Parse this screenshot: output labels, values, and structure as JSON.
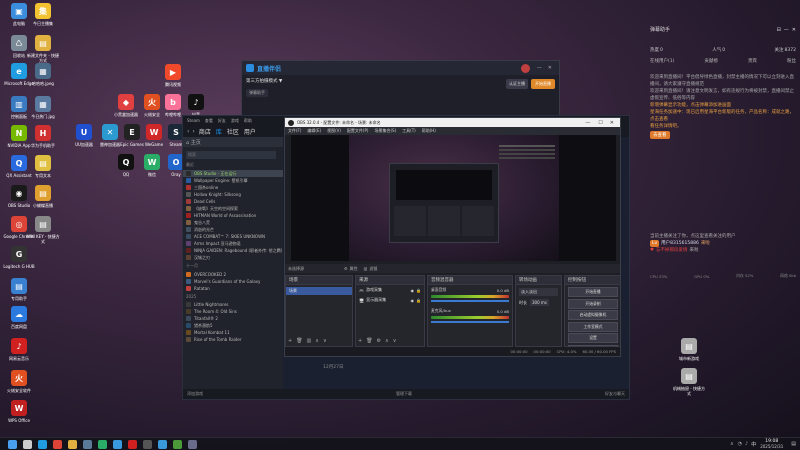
{
  "desktop": {
    "icons": [
      {
        "label": "此电脑",
        "color": "#3b8edb",
        "glyph": "▣"
      },
      {
        "label": "今日主播集",
        "color": "#f2c230",
        "glyph": "集"
      },
      {
        "label": "回收站",
        "color": "#7a8a96",
        "glyph": "♺"
      },
      {
        "label": "新建文件夹 - 快捷方式",
        "color": "#e0b040",
        "glyph": "▤"
      },
      {
        "label": "Microsoft Edge",
        "color": "#1f9de0",
        "glyph": "e"
      },
      {
        "label": "哈哈哈.jpeg",
        "color": "#4a6a8a",
        "glyph": "▦"
      },
      {
        "label": "控制面板",
        "color": "#3a7ac0",
        "glyph": "▥"
      },
      {
        "label": "今日热门.jpg",
        "color": "#5a7aa0",
        "glyph": "▦"
      },
      {
        "label": "NVIDIA App",
        "color": "#76b900",
        "glyph": "N"
      },
      {
        "label": "华为手机助手",
        "color": "#d03030",
        "glyph": "H"
      },
      {
        "label": "QX Assistant",
        "color": "#2a6adf",
        "glyph": "Q"
      },
      {
        "label": "专用文本",
        "color": "#e0c040",
        "glyph": "▤"
      },
      {
        "label": "OBS Studio",
        "color": "#1a1a1a",
        "glyph": "◉"
      },
      {
        "label": "小蝴蝶直播",
        "color": "#e0a030",
        "glyph": "▤"
      },
      {
        "label": "Google Chrome",
        "color": "#db4437",
        "glyph": "◎"
      },
      {
        "label": "MIKI KEY - 快捷方式",
        "color": "#888",
        "glyph": "▤"
      },
      {
        "label": "Logitech G HUB",
        "color": "#333",
        "glyph": "G"
      },
      {
        "label": "专用助手",
        "color": "#3a80d0",
        "glyph": "▤"
      },
      {
        "label": "百度网盘",
        "color": "#2a7ae0",
        "glyph": "☁"
      },
      {
        "label": "网易云音乐",
        "color": "#d02020",
        "glyph": "♪"
      },
      {
        "label": "火绒安全软件",
        "color": "#e05020",
        "glyph": "火"
      },
      {
        "label": "WPS Office",
        "color": "#c02020",
        "glyph": "W"
      }
    ],
    "middle_icons": [
      {
        "label": "腾讯视频",
        "color": "#f04a2a",
        "glyph": "▶"
      },
      {
        "label": "小黑盒加速器",
        "color": "#e04040",
        "glyph": "◆"
      },
      {
        "label": "火绒安全",
        "color": "#e05020",
        "glyph": "火"
      },
      {
        "label": "哔哩哔哩",
        "color": "#fb7299",
        "glyph": "b"
      },
      {
        "label": "抖音",
        "color": "#111",
        "glyph": "♪"
      },
      {
        "label": "UU加速器",
        "color": "#2050d0",
        "glyph": "U"
      },
      {
        "label": "雷神加速器",
        "color": "#2a9ad0",
        "glyph": "✕"
      },
      {
        "label": "Epic Games",
        "color": "#222",
        "glyph": "E"
      },
      {
        "label": "WeGame",
        "color": "#d02828",
        "glyph": "W"
      },
      {
        "label": "Steam",
        "color": "#1b2838",
        "glyph": "S"
      },
      {
        "label": "QQ",
        "color": "#111",
        "glyph": "Q"
      },
      {
        "label": "微信",
        "color": "#2aae67",
        "glyph": "W"
      },
      {
        "label": "Oray",
        "color": "#2266cc",
        "glyph": "O"
      }
    ]
  },
  "stream_app": {
    "title": "直播伴侣",
    "room": "第三方拍摄模式 ▼",
    "viewers": "弹幕助手",
    "live_label": "开始直播",
    "mic": "专注",
    "btn1": "认证主播",
    "btn2": "分享"
  },
  "steam": {
    "menu": [
      "Steam",
      "查看",
      "好友",
      "游戏",
      "帮助"
    ],
    "nav": [
      "商店",
      "库",
      "社区",
      "用户"
    ],
    "search": "搜索",
    "section_recent": "最近",
    "games": [
      {
        "name": "OBS Studio - 正在运行",
        "color": "#2a2a2a",
        "active": true
      },
      {
        "name": "Wallpaper Engine: 壁纸引擎",
        "color": "#2a5aa0"
      },
      {
        "name": "三国杀online",
        "color": "#b03030"
      },
      {
        "name": "Hollow Knight: Silksong",
        "color": "#555"
      },
      {
        "name": "Dead Cells",
        "color": "#a03a3a"
      },
      {
        "name": "《缺氧》天空的空间探索",
        "color": "#806040"
      },
      {
        "name": "HITMAN World of Assassination",
        "color": "#a02020"
      },
      {
        "name": "鬼谷八荒",
        "color": "#806040"
      },
      {
        "name": "消逝的光芒",
        "color": "#405060"
      },
      {
        "name": "ACE COMBAT™ 7: SKIES UNKNOWN",
        "color": "#3a4a60"
      },
      {
        "name": "Arms Impact 亚马逊物语",
        "color": "#604070"
      },
      {
        "name": "NINJA GAIDEN: Ragebound (职者外传: 怒之羁)",
        "color": "#602020"
      },
      {
        "name": "汉城之刃",
        "color": "#5a4030"
      }
    ],
    "section_other": "十一月",
    "games2": [
      {
        "name": "OVERCOOKED 2",
        "color": "#d06a20"
      },
      {
        "name": "Marvel's Guardians of the Galaxy",
        "color": "#3a5a80"
      },
      {
        "name": "Ratatan",
        "color": "#c04040"
      }
    ],
    "section_year": "2025",
    "games3": [
      {
        "name": "Little Nightmares",
        "color": "#3a3a3a"
      },
      {
        "name": "The Room 4: Old Sins",
        "color": "#4a3a2a"
      },
      {
        "name": "Titanfall® 2",
        "color": "#3a4a5a"
      },
      {
        "name": "猎杀潜航5",
        "color": "#2a4a6a"
      },
      {
        "name": "Mortal Kombat 11",
        "color": "#6a4a20"
      },
      {
        "name": "Rise of the Tomb Raider",
        "color": "#5a4a3a"
      }
    ],
    "add_game": "添加游戏",
    "downloads": "管理下载",
    "friends": "好友与聊天"
  },
  "obs": {
    "title": "OBS 32.0.4 - 配置文件: 未命名 - 场景: 未命名",
    "menu": [
      "文件(F)",
      "编辑(E)",
      "视图(V)",
      "配置文件(P)",
      "场景集合(S)",
      "工具(T)",
      "帮助(H)"
    ],
    "no_source": "未选择源",
    "properties": "属性",
    "filters": "滤镜",
    "scenes_title": "场景",
    "scene_item": "场景",
    "sources_title": "来源",
    "sources": [
      "游戏采集",
      "显示器采集"
    ],
    "mixer_title": "音频混音器",
    "audio1": "桌面音频",
    "audio1_db": "0.0 dB",
    "audio2": "麦克风/Aux",
    "audio2_db": "0.0 dB",
    "trans_title": "转场动画",
    "trans_type": "淡入淡出",
    "duration_label": "时长",
    "duration_val": "300 ms",
    "controls_title": "控制按钮",
    "ctrl": [
      "开始直播",
      "开始录制",
      "启动虚拟摄像机",
      "工作室模式",
      "设置",
      "退出"
    ],
    "status_time1": "00:00:00",
    "status_time2": "00:00:00",
    "status_cpu": "CPU: 4.0%",
    "status_fps": "60.00 / 60.00 FPS"
  },
  "chat": {
    "title": "弹幕助手",
    "stats": [
      {
        "label": "热度",
        "value": "0"
      },
      {
        "label": "人气",
        "value": "0"
      },
      {
        "label": "关注",
        "value": "8372"
      }
    ],
    "tabs": [
      "在线用户(1)",
      "贡献榜",
      "贵宾",
      "粉丝"
    ],
    "lines": [
      "欢迎来到直播间！平台倡导绿色直播，封禁主播的情况下可以立刻进入直播间，请大家遵守直播规范",
      "欢迎来到直播间！请注意文明发言，如有违规行为将被封禁，直播间禁止虚假宣传、低俗等内容",
      "新增弹幕显示功能，点击弹幕添加进画面",
      "星海任务加速中：现已启用星海平台新版的任务，产品名称：成就之路，点击查看",
      "看任务详情吧。"
    ],
    "action": "去查看",
    "bottom_lines": [
      "当前主播关注了你，点这里查看关注的用户",
      "[礼物] 送出了[棒棒糖]",
      "关注主播 开播提醒"
    ],
    "gift_user": "用户8315615886",
    "gift_text": "来啦",
    "gift2": "忘不掉那段爱情",
    "gift2_tail": "来啦",
    "metrics": [
      "CPU 33%",
      "GPU 0%",
      "内存 52%",
      "网络 0kb"
    ]
  },
  "desktop_right": {
    "icons": [
      {
        "label": "城市新游戏",
        "color": "#aaa",
        "glyph": "▤"
      },
      {
        "label": "机械抽屉 - 快捷方式",
        "color": "#aaa",
        "glyph": "▤"
      }
    ]
  },
  "taskbar": {
    "time": "19:08",
    "date": "2025/12/31",
    "lang": "中",
    "icons": [
      {
        "name": "start",
        "color": "#4aa0f0"
      },
      {
        "name": "search",
        "color": "#ccc"
      },
      {
        "name": "edge",
        "color": "#1f9de0"
      },
      {
        "name": "chrome",
        "color": "#db4437"
      },
      {
        "name": "explorer",
        "color": "#e0b040"
      },
      {
        "name": "steam",
        "color": "#5a7a9a"
      },
      {
        "name": "wechat",
        "color": "#2aae67"
      },
      {
        "name": "qq",
        "color": "#3a9ae0"
      },
      {
        "name": "music",
        "color": "#d02020"
      },
      {
        "name": "obs",
        "color": "#555"
      },
      {
        "name": "stream",
        "color": "#3a9ad8"
      },
      {
        "name": "game",
        "color": "#4a9a3a"
      },
      {
        "name": "store",
        "color": "#6a6a8a"
      }
    ]
  }
}
